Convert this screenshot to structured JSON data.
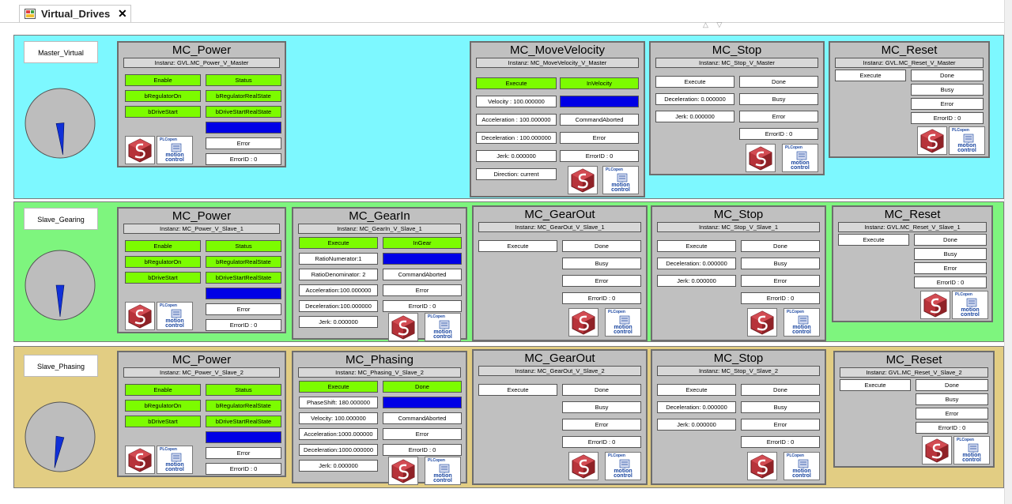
{
  "tab": {
    "title": "Virtual_Drives",
    "close": "✕"
  },
  "scroll_arrows": "△ ▽",
  "colors": {
    "band_master": "#7df8ff",
    "band_gearing": "#7ef57e",
    "band_phasing": "#e2cd83",
    "pin_green": "#7cfc00",
    "pin_blue": "#0000e6"
  },
  "logos": {
    "plcopen": "PLCopen",
    "motion": "motion control",
    "icon": "cube-s-logo-icon"
  },
  "axes": [
    {
      "label": "Master_Virtual"
    },
    {
      "label": "Slave_Gearing"
    },
    {
      "label": "Slave_Phasing"
    }
  ],
  "gauges": [
    {
      "needle_angle_deg": 175
    },
    {
      "needle_angle_deg": 180
    },
    {
      "needle_angle_deg": 190
    }
  ],
  "blocks": {
    "r0_power": {
      "title": "MC_Power",
      "instance": "Instanz: GVL.MC_Power_V_Master",
      "in": [
        "Enable",
        "bRegulatorOn",
        "bDriveStart"
      ],
      "out": [
        "Status",
        "bRegulatorRealState",
        "bDriveStartRealState",
        "Busy",
        "Error",
        "ErrorID : 0"
      ]
    },
    "r0_movevel": {
      "title": "MC_MoveVelocity",
      "instance": "Instanz: MC_MoveVelocity_V_Master",
      "in": [
        "Execute",
        "Velocity : 100.000000",
        "Acceleration : 100.000000",
        "Deceleration : 100.000000",
        "Jerk: 0.000000",
        "Direction: current"
      ],
      "out": [
        "InVelocity",
        "Busy",
        "CommandAborted",
        "Error",
        "ErrorID : 0"
      ]
    },
    "r0_stop": {
      "title": "MC_Stop",
      "instance": "Instanz: MC_Stop_V_Master",
      "in": [
        "Execute",
        "Deceleration: 0.000000",
        "Jerk: 0.000000"
      ],
      "out": [
        "Done",
        "Busy",
        "Error",
        "ErrorID : 0"
      ]
    },
    "r0_reset": {
      "title": "MC_Reset",
      "instance": "Instanz: GVL.MC_Reset_V_Master",
      "in": [
        "Execute"
      ],
      "out": [
        "Done",
        "Busy",
        "Error",
        "ErrorID : 0"
      ]
    },
    "r1_power": {
      "title": "MC_Power",
      "instance": "Instanz: MC_Power_V_Slave_1",
      "in": [
        "Enable",
        "bRegulatorOn",
        "bDriveStart"
      ],
      "out": [
        "Status",
        "bRegulatorRealState",
        "bDriveStartRealState",
        "Busy",
        "Error",
        "ErrorID : 0"
      ]
    },
    "r1_gearin": {
      "title": "MC_GearIn",
      "instance": "Instanz: MC_GearIn_V_Slave_1",
      "in": [
        "Execute",
        "RatioNumerator:1",
        "RatioDenominator: 2",
        "Acceleration:100.000000",
        "Deceleration:100.000000",
        "Jerk: 0.000000"
      ],
      "out": [
        "InGear",
        "Busy",
        "CommandAborted",
        "Error",
        "ErrorID : 0"
      ]
    },
    "r1_gearout": {
      "title": "MC_GearOut",
      "instance": "Instanz: MC_GearOut_V_Slave_1",
      "in": [
        "Execute"
      ],
      "out": [
        "Done",
        "Busy",
        "Error",
        "ErrorID : 0"
      ]
    },
    "r1_stop": {
      "title": "MC_Stop",
      "instance": "Instanz: MC_Stop_V_Slave_1",
      "in": [
        "Execute",
        "Deceleration: 0.000000",
        "Jerk: 0.000000"
      ],
      "out": [
        "Done",
        "Busy",
        "Error",
        "ErrorID : 0"
      ]
    },
    "r1_reset": {
      "title": "MC_Reset",
      "instance": "Instanz: GVL.MC_Reset_V_Slave_1",
      "in": [
        "Execute"
      ],
      "out": [
        "Done",
        "Busy",
        "Error",
        "ErrorID : 0"
      ]
    },
    "r2_power": {
      "title": "MC_Power",
      "instance": "Instanz: MC_Power_V_Slave_2",
      "in": [
        "Enable",
        "bRegulatorOn",
        "bDriveStart"
      ],
      "out": [
        "Status",
        "bRegulatorRealState",
        "bDriveStartRealState",
        "Busy",
        "Error",
        "ErrorID : 0"
      ]
    },
    "r2_phasing": {
      "title": "MC_Phasing",
      "instance": "Instanz: MC_Phasing_V_Slave_2",
      "in": [
        "Execute",
        "PhaseShift: 180.000000",
        "Velocity: 100.000000",
        "Acceleration:1000.000000",
        "Deceleration:1000.000000",
        "Jerk: 0.000000"
      ],
      "out": [
        "Done",
        "Busy",
        "CommandAborted",
        "Error",
        "ErrorID : 0"
      ]
    },
    "r2_gearout": {
      "title": "MC_GearOut",
      "instance": "Instanz: MC_GearOut_V_Slave_2",
      "in": [
        "Execute"
      ],
      "out": [
        "Done",
        "Busy",
        "Error",
        "ErrorID : 0"
      ]
    },
    "r2_stop": {
      "title": "MC_Stop",
      "instance": "Instanz: MC_Stop_V_Slave_2",
      "in": [
        "Execute",
        "Deceleration: 0.000000",
        "Jerk: 0.000000"
      ],
      "out": [
        "Done",
        "Busy",
        "Error",
        "ErrorID : 0"
      ]
    },
    "r2_reset": {
      "title": "MC_Reset",
      "instance": "Instanz: GVL.MC_Reset_V_Slave_2",
      "in": [
        "Execute"
      ],
      "out": [
        "Done",
        "Busy",
        "Error",
        "ErrorID : 0"
      ]
    }
  }
}
